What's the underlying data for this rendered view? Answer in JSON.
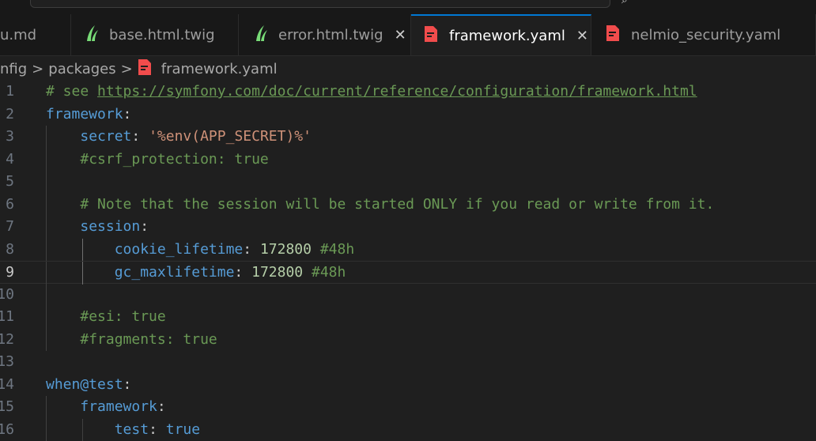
{
  "tabs": [
    {
      "label": "u.md",
      "icon": "",
      "active": false
    },
    {
      "label": "base.html.twig",
      "icon": "twig-icon",
      "active": false
    },
    {
      "label": "error.html.twig",
      "icon": "twig-icon",
      "active": false,
      "close": "✕"
    },
    {
      "label": "framework.yaml",
      "icon": "yaml-icon",
      "active": true,
      "close": "✕"
    },
    {
      "label": "nelmio_security.yaml",
      "icon": "yaml-icon",
      "active": false
    }
  ],
  "breadcrumb": {
    "part1": "nfig",
    "part2": "packages",
    "file": "framework.yaml",
    "sep": ">"
  },
  "colors": {
    "comment": "#6a9955",
    "key": "#569cd6",
    "string": "#ce9178",
    "number": "#b5cea8",
    "accent": "#0078d4"
  },
  "lines": [
    {
      "n": "1",
      "indent": "",
      "parts": [
        {
          "t": "# see ",
          "c": "c"
        },
        {
          "t": "https://symfony.com/doc/current/reference/configuration/framework.html",
          "c": "link"
        }
      ]
    },
    {
      "n": "2",
      "indent": "",
      "parts": [
        {
          "t": "framework",
          "c": "k"
        },
        {
          "t": ":",
          "c": "p"
        }
      ]
    },
    {
      "n": "3",
      "indent": "    ",
      "parts": [
        {
          "t": "secret",
          "c": "k"
        },
        {
          "t": ": ",
          "c": "p"
        },
        {
          "t": "'%env(APP_SECRET)%'",
          "c": "s"
        }
      ]
    },
    {
      "n": "4",
      "indent": "    ",
      "parts": [
        {
          "t": "#csrf_protection: true",
          "c": "c"
        }
      ]
    },
    {
      "n": "5",
      "indent": "",
      "parts": []
    },
    {
      "n": "6",
      "indent": "    ",
      "parts": [
        {
          "t": "# Note that the session will be started ONLY if you read or write from it.",
          "c": "c"
        }
      ]
    },
    {
      "n": "7",
      "indent": "    ",
      "parts": [
        {
          "t": "session",
          "c": "k"
        },
        {
          "t": ":",
          "c": "p"
        }
      ]
    },
    {
      "n": "8",
      "indent": "        ",
      "parts": [
        {
          "t": "cookie_lifetime",
          "c": "k"
        },
        {
          "t": ": ",
          "c": "p"
        },
        {
          "t": "172800",
          "c": "n"
        },
        {
          "t": " #48h",
          "c": "c"
        }
      ]
    },
    {
      "n": "9",
      "indent": "        ",
      "parts": [
        {
          "t": "gc_maxlifetime",
          "c": "k"
        },
        {
          "t": ": ",
          "c": "p"
        },
        {
          "t": "172800",
          "c": "n"
        },
        {
          "t": " #48h",
          "c": "c"
        }
      ]
    },
    {
      "n": "10",
      "indent": "",
      "parts": []
    },
    {
      "n": "11",
      "indent": "    ",
      "parts": [
        {
          "t": "#esi: true",
          "c": "c"
        }
      ]
    },
    {
      "n": "12",
      "indent": "    ",
      "parts": [
        {
          "t": "#fragments: true",
          "c": "c"
        }
      ]
    },
    {
      "n": "13",
      "indent": "",
      "parts": []
    },
    {
      "n": "14",
      "indent": "",
      "parts": [
        {
          "t": "when@test",
          "c": "k"
        },
        {
          "t": ":",
          "c": "p"
        }
      ]
    },
    {
      "n": "15",
      "indent": "    ",
      "parts": [
        {
          "t": "framework",
          "c": "k"
        },
        {
          "t": ":",
          "c": "p"
        }
      ]
    },
    {
      "n": "16",
      "indent": "        ",
      "parts": [
        {
          "t": "test",
          "c": "k"
        },
        {
          "t": ": ",
          "c": "p"
        },
        {
          "t": "true",
          "c": "v"
        }
      ]
    }
  ]
}
